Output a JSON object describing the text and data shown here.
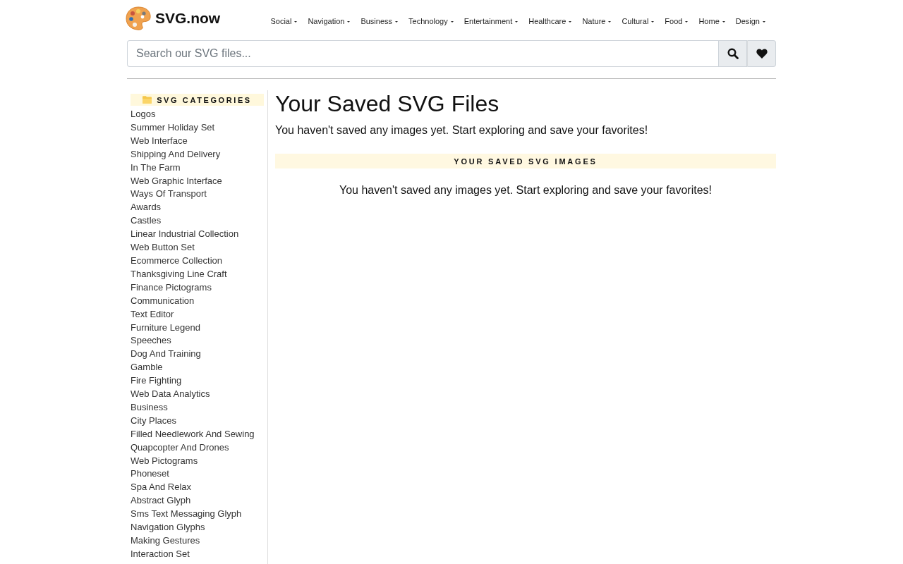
{
  "header": {
    "logo": {
      "text": "SVG.now"
    },
    "nav": [
      "Social",
      "Navigation",
      "Business",
      "Technology",
      "Entertainment",
      "Healthcare",
      "Nature",
      "Cultural",
      "Food",
      "Home",
      "Design"
    ]
  },
  "search": {
    "placeholder": "Search our SVG files..."
  },
  "sidebar": {
    "title": "SVG CATEGORIES",
    "items": [
      "Logos",
      "Summer Holiday Set",
      "Web Interface",
      "Shipping And Delivery",
      "In The Farm",
      "Web Graphic Interface",
      "Ways Of Transport",
      "Awards",
      "Castles",
      "Linear Industrial Collection",
      "Web Button Set",
      "Ecommerce Collection",
      "Thanksgiving Line Craft",
      "Finance Pictograms",
      "Communication",
      "Text Editor",
      "Furniture Legend",
      "Speeches",
      "Dog And Training",
      "Gamble",
      "Fire Fighting",
      "Web Data Analytics",
      "Business",
      "City Places",
      "Filled Needlework And Sewing",
      "Quapcopter And Drones",
      "Web Pictograms",
      "Phoneset",
      "Spa And Relax",
      "Abstract Glyph",
      "Sms Text Messaging Glyph",
      "Navigation Glyphs",
      "Making Gestures",
      "Interaction Set"
    ]
  },
  "main": {
    "title": "Your Saved SVG Files",
    "message": "You haven't saved any images yet. Start exploring and save your favorites!",
    "section": {
      "title": "YOUR SAVED SVG IMAGES",
      "empty_message": "You haven't saved any images yet. Start exploring and save your favorites!"
    }
  }
}
